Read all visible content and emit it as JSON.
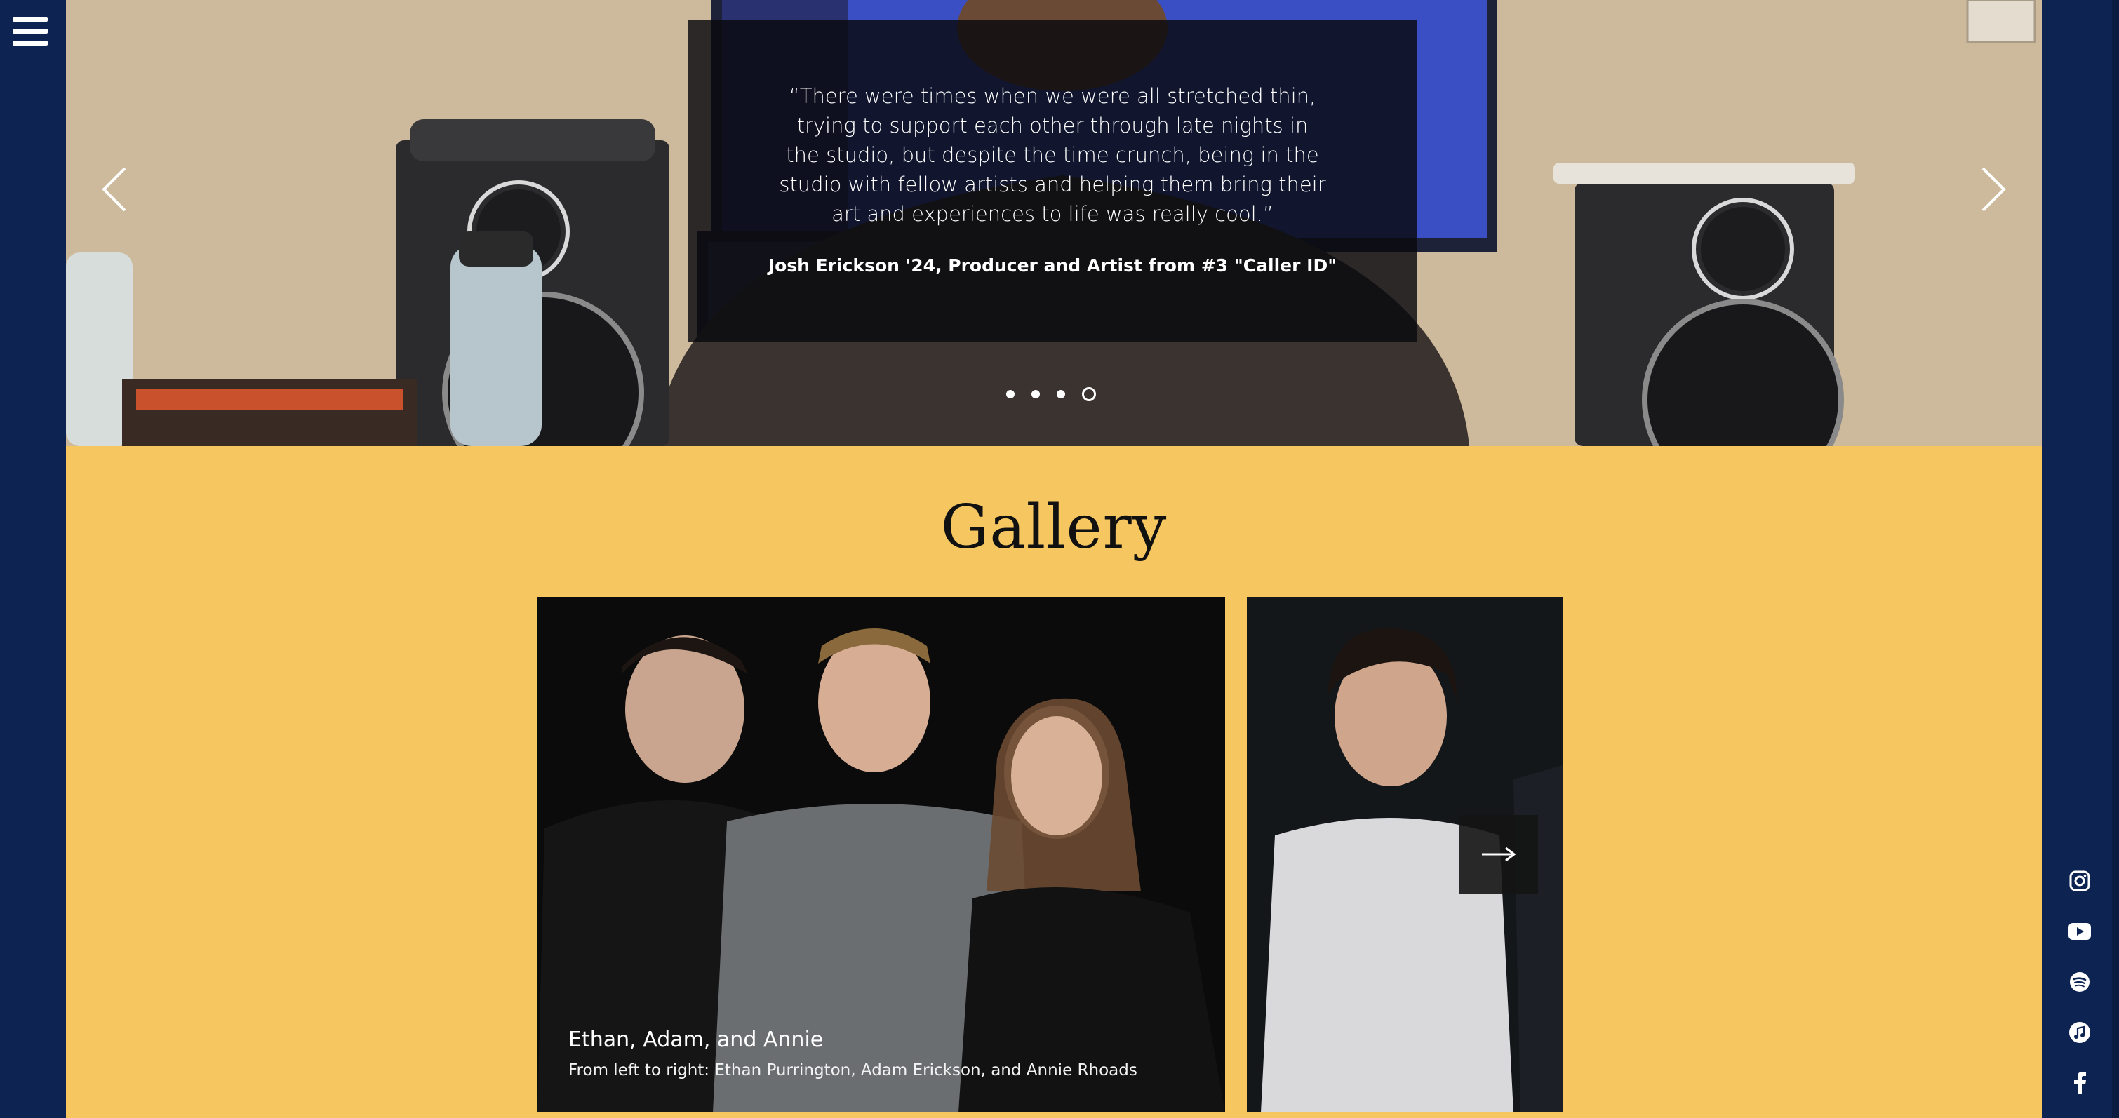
{
  "nav": {
    "menu_icon": "hamburger-menu-icon"
  },
  "hero": {
    "quote": "“There were times when we were all stretched thin, trying to support each other through late nights in the studio, but despite the time crunch, being in the studio with fellow artists and helping them bring their art and experiences to life was really cool.”",
    "author": "Josh Erickson '24, Producer and Artist from #3 \"Caller ID\"",
    "prev_icon": "chevron-left-icon",
    "next_icon": "chevron-right-icon",
    "slides_total": 4,
    "active_slide": 4
  },
  "gallery": {
    "title": "Gallery",
    "items": [
      {
        "title": "Ethan, Adam, and Annie",
        "description": "From left to right: Ethan Purrington, Adam Erickson, and Annie Rhoads"
      }
    ],
    "next_icon": "arrow-right-icon"
  },
  "social": {
    "icons": [
      "instagram-icon",
      "youtube-icon",
      "spotify-icon",
      "apple-music-icon",
      "facebook-icon"
    ]
  },
  "colors": {
    "navy": "#0d2452",
    "gallery_bg": "#f6c761",
    "quote_bg": "#08080e"
  }
}
